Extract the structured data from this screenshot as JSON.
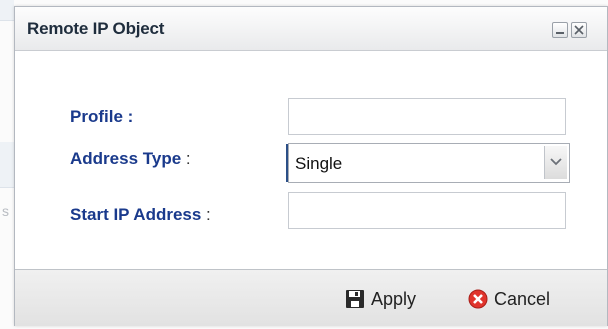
{
  "dialog": {
    "title": "Remote IP Object",
    "minimize_icon": "minimize-icon",
    "close_icon": "close-icon"
  },
  "form": {
    "profile_label": "Profile :",
    "profile_value": "",
    "address_type_label": "Address Type",
    "address_type_colon": " :",
    "address_type_value": "Single",
    "start_ip_label": "Start IP Address",
    "start_ip_colon": " :",
    "start_ip_value": ""
  },
  "footer": {
    "apply_label": "Apply",
    "apply_icon": "save-icon",
    "cancel_label": "Cancel",
    "cancel_icon": "cancel-icon"
  },
  "background": {
    "partial_text": "s"
  },
  "colors": {
    "label": "#1a3a8c",
    "cancel_icon": "#e0342c"
  }
}
